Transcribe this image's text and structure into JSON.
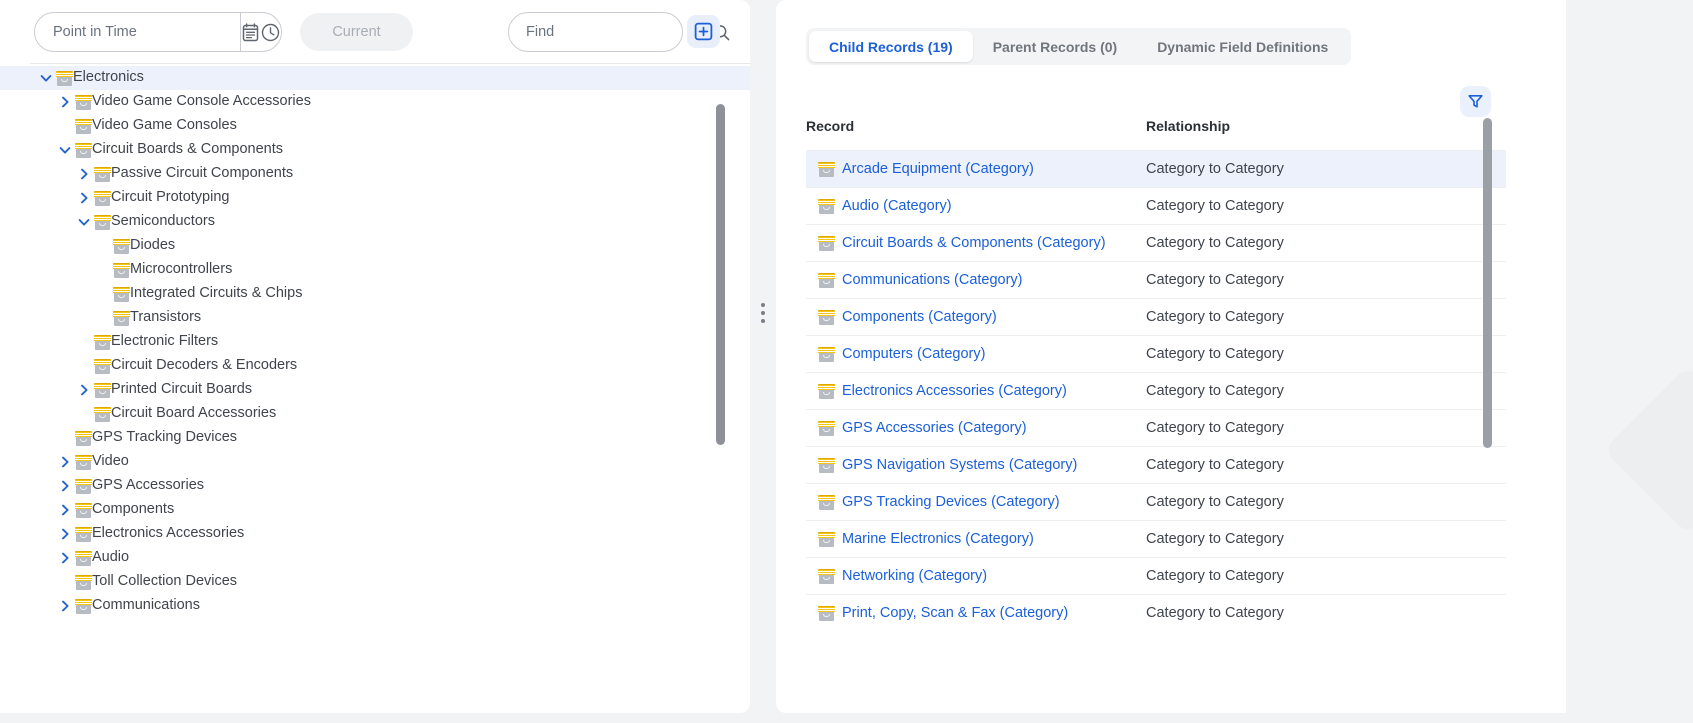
{
  "left_panel": {
    "toolbar": {
      "point_in_time_placeholder": "Point in Time",
      "point_in_time_value": "",
      "calendar_icon": "calendar-icon",
      "clock_icon": "clock-icon",
      "current_label": "Current",
      "find_placeholder": "Find",
      "find_value": "",
      "search_icon": "search-icon",
      "add_icon": "add-box-icon"
    },
    "tree": [
      {
        "label": "Electronics",
        "depth": 0,
        "twisty": "down",
        "selected": true
      },
      {
        "label": "Video Game Console Accessories",
        "depth": 1,
        "twisty": "right",
        "selected": false
      },
      {
        "label": "Video Game Consoles",
        "depth": 1,
        "twisty": "none",
        "selected": false
      },
      {
        "label": "Circuit Boards & Components",
        "depth": 1,
        "twisty": "down",
        "selected": false
      },
      {
        "label": "Passive Circuit Components",
        "depth": 2,
        "twisty": "right",
        "selected": false
      },
      {
        "label": "Circuit Prototyping",
        "depth": 2,
        "twisty": "right",
        "selected": false
      },
      {
        "label": "Semiconductors",
        "depth": 2,
        "twisty": "down",
        "selected": false
      },
      {
        "label": "Diodes",
        "depth": 3,
        "twisty": "none",
        "selected": false
      },
      {
        "label": "Microcontrollers",
        "depth": 3,
        "twisty": "none",
        "selected": false
      },
      {
        "label": "Integrated Circuits & Chips",
        "depth": 3,
        "twisty": "none",
        "selected": false
      },
      {
        "label": "Transistors",
        "depth": 3,
        "twisty": "none",
        "selected": false
      },
      {
        "label": "Electronic Filters",
        "depth": 2,
        "twisty": "none",
        "selected": false
      },
      {
        "label": "Circuit Decoders & Encoders",
        "depth": 2,
        "twisty": "none",
        "selected": false
      },
      {
        "label": "Printed Circuit Boards",
        "depth": 2,
        "twisty": "right",
        "selected": false
      },
      {
        "label": "Circuit Board Accessories",
        "depth": 2,
        "twisty": "none",
        "selected": false
      },
      {
        "label": "GPS Tracking Devices",
        "depth": 1,
        "twisty": "none",
        "selected": false
      },
      {
        "label": "Video",
        "depth": 1,
        "twisty": "right",
        "selected": false
      },
      {
        "label": "GPS Accessories",
        "depth": 1,
        "twisty": "right",
        "selected": false
      },
      {
        "label": "Components",
        "depth": 1,
        "twisty": "right",
        "selected": false
      },
      {
        "label": "Electronics Accessories",
        "depth": 1,
        "twisty": "right",
        "selected": false
      },
      {
        "label": "Audio",
        "depth": 1,
        "twisty": "right",
        "selected": false
      },
      {
        "label": "Toll Collection Devices",
        "depth": 1,
        "twisty": "none",
        "selected": false
      },
      {
        "label": "Communications",
        "depth": 1,
        "twisty": "right",
        "selected": false
      }
    ]
  },
  "right_panel": {
    "tabs": [
      {
        "label": "Child Records (19)",
        "active": true
      },
      {
        "label": "Parent Records (0)",
        "active": false
      },
      {
        "label": "Dynamic Field Definitions",
        "active": false
      }
    ],
    "filter_icon": "filter-funnel-icon",
    "table": {
      "columns": [
        "Record",
        "Relationship"
      ],
      "rows": [
        {
          "record": "Arcade Equipment (Category)",
          "relationship": "Category to Category",
          "selected": true
        },
        {
          "record": "Audio (Category)",
          "relationship": "Category to Category",
          "selected": false
        },
        {
          "record": "Circuit Boards & Components (Category)",
          "relationship": "Category to Category",
          "selected": false
        },
        {
          "record": "Communications (Category)",
          "relationship": "Category to Category",
          "selected": false
        },
        {
          "record": "Components (Category)",
          "relationship": "Category to Category",
          "selected": false
        },
        {
          "record": "Computers (Category)",
          "relationship": "Category to Category",
          "selected": false
        },
        {
          "record": "Electronics Accessories (Category)",
          "relationship": "Category to Category",
          "selected": false
        },
        {
          "record": "GPS Accessories (Category)",
          "relationship": "Category to Category",
          "selected": false
        },
        {
          "record": "GPS Navigation Systems (Category)",
          "relationship": "Category to Category",
          "selected": false
        },
        {
          "record": "GPS Tracking Devices (Category)",
          "relationship": "Category to Category",
          "selected": false
        },
        {
          "record": "Marine Electronics (Category)",
          "relationship": "Category to Category",
          "selected": false
        },
        {
          "record": "Networking (Category)",
          "relationship": "Category to Category",
          "selected": false
        },
        {
          "record": "Print, Copy, Scan & Fax (Category)",
          "relationship": "Category to Category",
          "selected": false
        }
      ]
    }
  },
  "colors": {
    "accent_blue": "#1b5fd9",
    "twisty_blue": "#2563c9",
    "selected_row": "#ecf1fb",
    "icon_yellow": "#f5c518",
    "icon_gray": "#b7bbc2",
    "page_bg": "#f2f3f5",
    "scrollbar": "#8e9298"
  }
}
